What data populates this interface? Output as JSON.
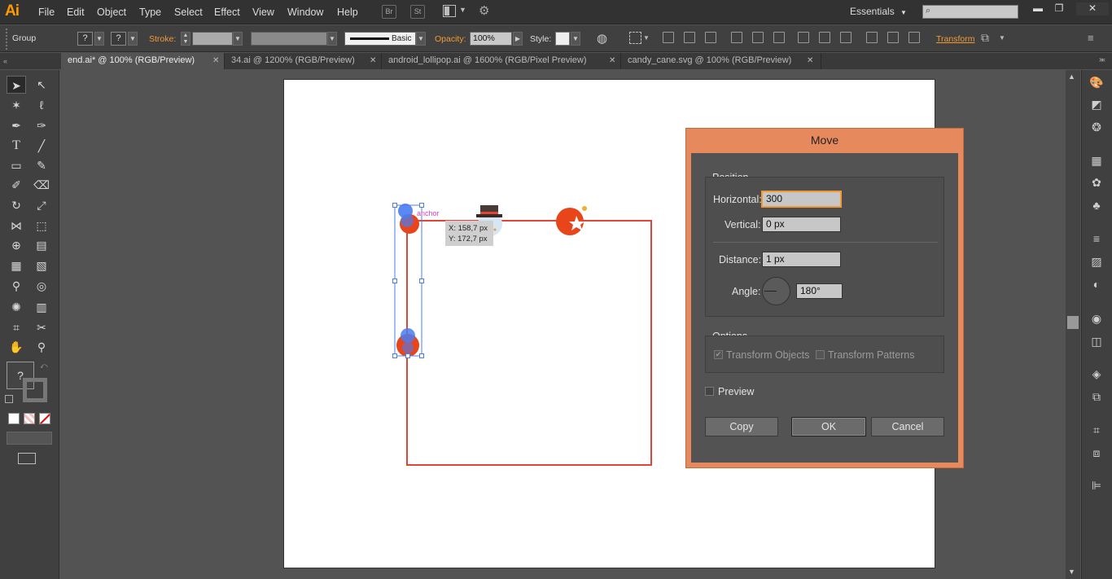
{
  "app": {
    "logo": "Ai"
  },
  "menubar": {
    "items": [
      "File",
      "Edit",
      "Object",
      "Type",
      "Select",
      "Effect",
      "View",
      "Window",
      "Help"
    ],
    "bridge_label": "Br",
    "stock_label": "St",
    "workspace": "Essentials"
  },
  "control_bar": {
    "selection_type": "Group",
    "fill_label": "?",
    "stroke_swatch_label": "?",
    "stroke_label": "Stroke:",
    "brush_label": "Basic",
    "opacity_label": "Opacity:",
    "opacity_value": "100%",
    "style_label": "Style:",
    "transform_label": "Transform"
  },
  "tabs": [
    {
      "label": "end.ai* @ 100% (RGB/Preview)",
      "active": true
    },
    {
      "label": "34.ai @ 1200% (RGB/Preview)",
      "active": false
    },
    {
      "label": "android_lollipop.ai @ 1600% (RGB/Pixel Preview)",
      "active": false
    },
    {
      "label": "candy_cane.svg @ 100% (RGB/Preview)",
      "active": false
    }
  ],
  "canvas": {
    "anchor_label": "anchor",
    "tooltip_x": "X: 158,7 px",
    "tooltip_y": "Y: 172,7 px"
  },
  "toolbar": {
    "fill_unknown": "?"
  },
  "move_dialog": {
    "title": "Move",
    "position_legend": "Position",
    "horizontal_label": "Horizontal:",
    "horizontal_value": "300",
    "vertical_label": "Vertical:",
    "vertical_value": "0 px",
    "distance_label": "Distance:",
    "distance_value": "1 px",
    "angle_label": "Angle:",
    "angle_value": "180°",
    "options_legend": "Options",
    "transform_objects_label": "Transform Objects",
    "transform_objects_checked": true,
    "transform_patterns_label": "Transform Patterns",
    "transform_patterns_checked": false,
    "preview_label": "Preview",
    "preview_checked": false,
    "copy_label": "Copy",
    "ok_label": "OK",
    "cancel_label": "Cancel"
  },
  "colors": {
    "accent": "#f29a35",
    "selection": "#4a7cf0",
    "path": "#e0453a",
    "dialog_border": "#e68a5e"
  }
}
